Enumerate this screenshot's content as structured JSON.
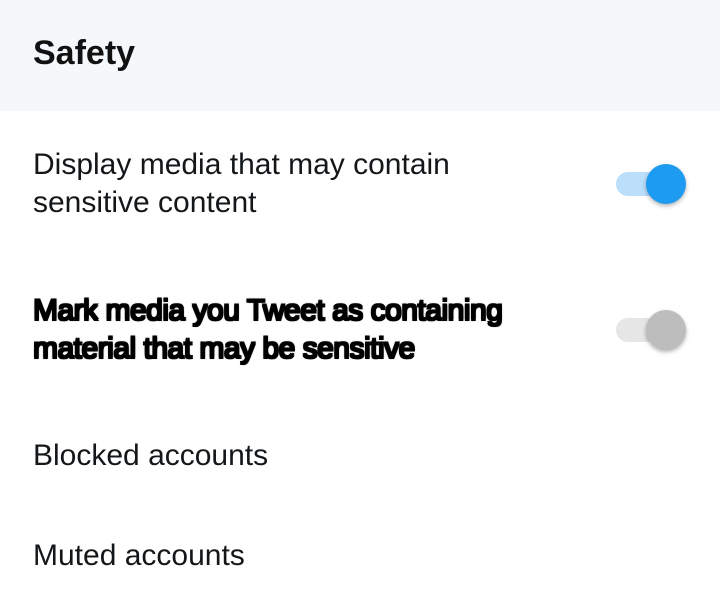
{
  "section": {
    "title": "Safety"
  },
  "settings": {
    "sensitive_display": {
      "line1": "Display media that may contain",
      "line2": "sensitive content",
      "enabled": true
    },
    "mark_sensitive": {
      "line1": "Mark media you Tweet as containing",
      "line2": "material that may be sensitive",
      "enabled": false
    }
  },
  "links": {
    "blocked": "Blocked accounts",
    "muted": "Muted accounts"
  },
  "colors": {
    "accent": "#1d9bf0",
    "accent_track": "#bbdefb",
    "off_knob": "#bdbdbd",
    "off_track": "#e6e6e6",
    "header_bg": "#f5f8fa"
  }
}
